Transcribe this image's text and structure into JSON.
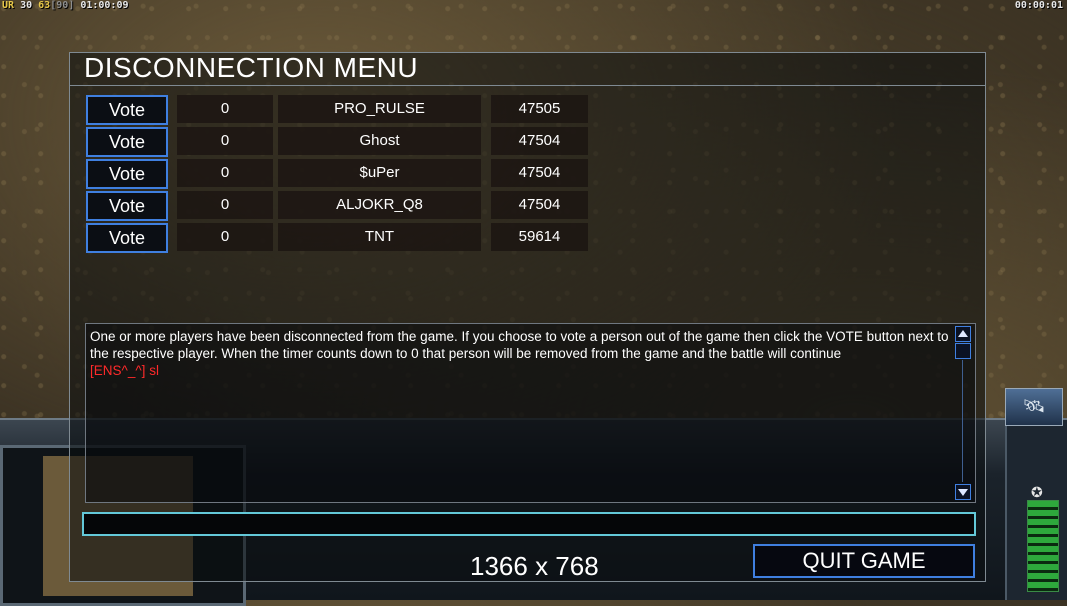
{
  "hud": {
    "top_left_a": "UR",
    "top_left_b": "30",
    "top_left_c": "63",
    "top_left_d": "[90]",
    "top_left_time": "01:00:09",
    "top_right_time": "00:00:01"
  },
  "dialog": {
    "title": "DISCONNECTION MENU",
    "vote_label": "Vote",
    "players": [
      {
        "timer": "0",
        "name": "PRO_RULSE",
        "ping": "47505"
      },
      {
        "timer": "0",
        "name": "Ghost",
        "ping": "47504"
      },
      {
        "timer": "0",
        "name": "$uPer",
        "ping": "47504"
      },
      {
        "timer": "0",
        "name": "ALJOKR_Q8",
        "ping": "47504"
      },
      {
        "timer": "0",
        "name": "TNT",
        "ping": "59614"
      }
    ],
    "message": "One or more players have been disconnected from the game. If you choose to vote a person out of the game then click the VOTE button next to the respective player. When the timer counts down to 0 that person will be removed from the game and the battle will continue",
    "chat_line": "[ENS^_^] sl",
    "chat_input_value": "",
    "resolution": "1366 x 768",
    "quit_label": "QUIT GAME"
  },
  "colors": {
    "button_border": "#3f7fe0",
    "chat_input_border": "#63c8d8",
    "chat_text": "#ff2a2a"
  }
}
